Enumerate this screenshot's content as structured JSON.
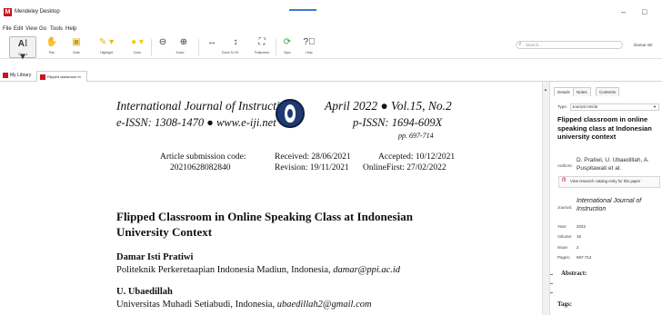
{
  "window": {
    "title": "Mendeley Desktop",
    "logo_letter": "M",
    "min": "–",
    "max": "□"
  },
  "menu": [
    "File",
    "Edit",
    "View",
    "Go",
    "Tools",
    "Help"
  ],
  "toolbar": {
    "select": "Select",
    "pan": "Pan",
    "note": "Note",
    "highlight": "Highlight",
    "color": "Color",
    "zoom": "Zoom",
    "zoom_to_fit": "Zoom To Fit",
    "fullscreen": "Fullscreen",
    "sync": "Sync",
    "help": "Help"
  },
  "search": {
    "placeholder": "Search...",
    "icon": "search-icon"
  },
  "user": {
    "name": "Damar Isti"
  },
  "tabs": {
    "library": "My Library",
    "document": "Flipped classroom in onlin...",
    "close": "x"
  },
  "pdf": {
    "journal_left_1": "International Journal of Instruction",
    "journal_left_2": "e-ISSN: 1308-1470 ● www.e-iji.net",
    "journal_right_1": "April 2022 ● Vol.15, No.2",
    "journal_right_2": "p-ISSN: 1694-609X",
    "pages": "pp. 697-714",
    "submission_label": "Article submission code:",
    "submission_code": "20210628082840",
    "received": "Received: 28/06/2021",
    "revision": "Revision: 19/11/2021",
    "accepted": "Accepted: 10/12/2021",
    "online_first": "OnlineFirst: 27/02/2022",
    "title": "Flipped Classroom in Online Speaking Class at Indonesian University Context",
    "author1": "Damar Isti Pratiwi",
    "author1_aff": "Politeknik Perkeretaapian Indonesia Madiun, Indonesia, ",
    "author1_email": "damar@ppi.ac.id",
    "author2": "U. Ubaedillah",
    "author2_aff": "Universitas Muhadi Setiabudi, Indonesia, ",
    "author2_email": "ubaedillah2@gmail.com"
  },
  "panel": {
    "tabs": [
      "Details",
      "Notes",
      "Contents"
    ],
    "type_label": "Type:",
    "type_value": "Journal Article",
    "title": "Flipped classroom in online speaking class at Indonesian university context",
    "authors_label": "Authors:",
    "authors_value": "D. Pratiwi, U. Ubaedillah, A. Puspitawati et al.",
    "catalog_link": "View research catalog entry for this paper",
    "journal_label": "Journal:",
    "journal_value": "International Journal of Instruction",
    "year_label": "Year:",
    "year_value": "2022",
    "volume_label": "Volume:",
    "volume_value": "15",
    "issue_label": "Issue:",
    "issue_value": "2",
    "pages_label": "Pages:",
    "pages_value": "697-714",
    "abstract_label": "Abstract:",
    "tags_label": "Tags:"
  },
  "colors": {
    "brand": "#c8141d",
    "journal_logo": "#1f3a73",
    "link": "#3a7bd5"
  }
}
